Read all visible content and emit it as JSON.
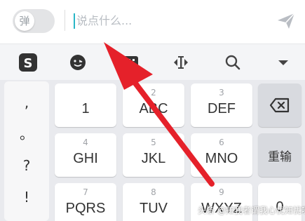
{
  "input_bar": {
    "toggle_label": "弹",
    "placeholder": "说点什么..."
  },
  "toolbar": {
    "icons": [
      "sogou-logo-icon",
      "emoji-icon",
      "keyboard-icon",
      "cursor-move-icon",
      "search-icon",
      "collapse-icon"
    ]
  },
  "keyboard": {
    "side_column": [
      ",",
      "。",
      "?",
      "!"
    ],
    "keys": [
      {
        "num": "",
        "main": "1"
      },
      {
        "num": "2",
        "main": "ABC"
      },
      {
        "num": "3",
        "main": "DEF"
      },
      {
        "num": "4",
        "main": "GHI"
      },
      {
        "num": "5",
        "main": "JKL"
      },
      {
        "num": "6",
        "main": "MNO"
      },
      {
        "num": "7",
        "main": "PQRS"
      },
      {
        "num": "8",
        "main": "TUV"
      },
      {
        "num": "9",
        "main": "WXYZ"
      }
    ],
    "reinput_label": "重输",
    "zero_label": "0"
  },
  "watermark": "头条 @知我者谓我心忧知忧呀",
  "colors": {
    "arrow": "#e5212a",
    "caret": "#29b6c6",
    "keyboard_bg": "#e9eaee"
  }
}
